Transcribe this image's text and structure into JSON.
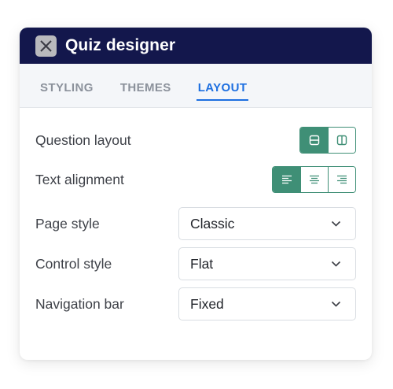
{
  "window": {
    "title": "Quiz designer"
  },
  "tabs": [
    {
      "label": "STYLING",
      "active": false
    },
    {
      "label": "THEMES",
      "active": false
    },
    {
      "label": "LAYOUT",
      "active": true
    }
  ],
  "settings": {
    "question_layout": {
      "label": "Question layout",
      "options": [
        "horizontal-layout-icon",
        "vertical-layout-icon"
      ],
      "selected": "horizontal-layout-icon"
    },
    "text_alignment": {
      "label": "Text alignment",
      "options": [
        "align-left-icon",
        "align-center-icon",
        "align-right-icon"
      ],
      "selected": "align-left-icon"
    },
    "page_style": {
      "label": "Page style",
      "value": "Classic"
    },
    "control_style": {
      "label": "Control style",
      "value": "Flat"
    },
    "navigation_bar": {
      "label": "Navigation bar",
      "value": "Fixed"
    }
  },
  "colors": {
    "titlebar": "#13174c",
    "accent_green": "#3f8f76",
    "active_tab": "#1d6fe0"
  }
}
